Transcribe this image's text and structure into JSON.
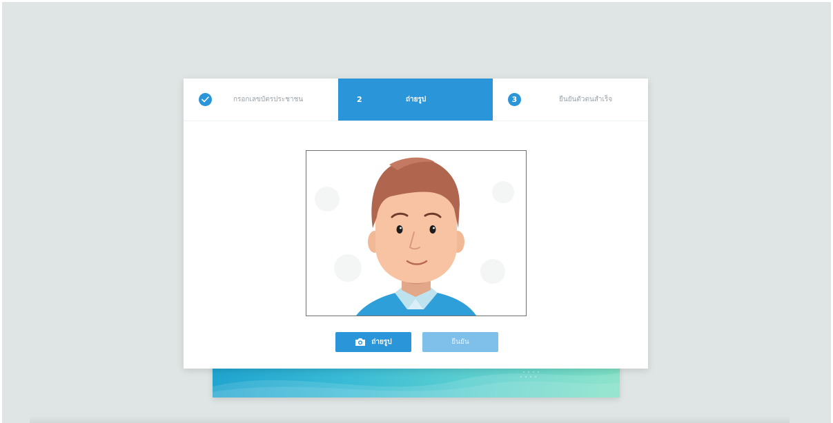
{
  "stepper": {
    "steps": [
      {
        "number": "1",
        "label": "กรอกเลขบัตรประชาชน",
        "state": "completed"
      },
      {
        "number": "2",
        "label": "ถ่ายรูป",
        "state": "active"
      },
      {
        "number": "3",
        "label": "ยืนยันตัวตนสำเร็จ",
        "state": "pending"
      }
    ]
  },
  "actions": {
    "capture_label": "ถ่ายรูป",
    "confirm_label": "ยืนยัน"
  },
  "icons": {
    "completed_step": "check-icon",
    "capture_button": "camera-icon"
  },
  "colors": {
    "primary": "#2a95d8",
    "disabled_button": "#7ec0ea",
    "background": "#dfe5e4"
  }
}
